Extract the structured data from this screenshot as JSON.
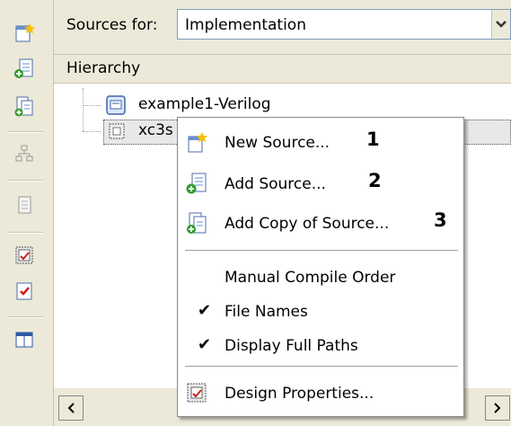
{
  "header": {
    "sources_label": "Sources for:",
    "sources_value": "Implementation",
    "dropdown_arrow": "❯"
  },
  "hierarchy": {
    "title": "Hierarchy",
    "items": [
      {
        "label": "example1-Verilog",
        "icon": "project-icon"
      },
      {
        "label": "xc3s",
        "icon": "chip-icon"
      }
    ]
  },
  "context_menu": {
    "items": [
      {
        "label": "New Source...",
        "number": "1",
        "icon": "new-source-icon"
      },
      {
        "label": "Add Source...",
        "number": "2",
        "icon": "add-source-icon"
      },
      {
        "label": "Add Copy of Source...",
        "number": "3",
        "icon": "add-copy-source-icon"
      },
      {
        "label": "Manual Compile Order",
        "checked": false
      },
      {
        "label": "File Names",
        "checked": true
      },
      {
        "label": "Display Full Paths",
        "checked": true
      },
      {
        "label": "Design Properties...",
        "icon": "design-properties-icon"
      }
    ],
    "check_glyph": "✔"
  },
  "scrollbar": {
    "left_arrow": "<",
    "right_arrow": ">"
  },
  "colors": {
    "toolbar_bg": "#ece9d8",
    "select_border": "#7f9db9"
  }
}
